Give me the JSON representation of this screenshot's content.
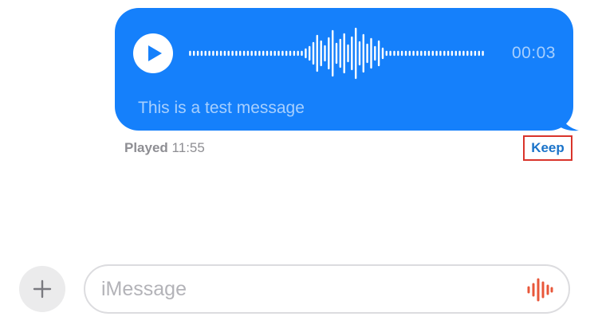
{
  "message": {
    "duration": "00:03",
    "transcript": "This is a test message",
    "played_label": "Played",
    "played_time": "11:55",
    "keep_label": "Keep",
    "bubble_color": "#1580fb"
  },
  "compose": {
    "placeholder": "iMessage",
    "value": ""
  },
  "icons": {
    "play": "play-icon",
    "plus": "plus-icon",
    "audio_wave": "audio-waveform-icon"
  },
  "colors": {
    "accent_blue": "#1580fb",
    "keep_text": "#1a73c9",
    "highlight_border": "#d9342b",
    "wave_icon": "#e8573a"
  }
}
